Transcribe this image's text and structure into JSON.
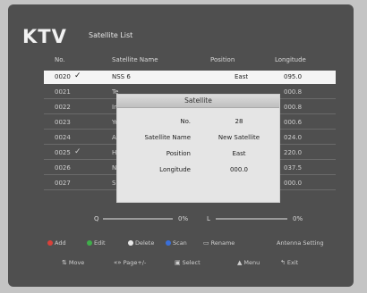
{
  "logo": "KTV",
  "title": "Satellite List",
  "columns": {
    "no": "No.",
    "name": "Satellite Name",
    "position": "Position",
    "longitude": "Longitude"
  },
  "rows": [
    {
      "no": "0020",
      "check": "✓",
      "name": "NSS 6",
      "position": "East",
      "longitude": "095.0"
    },
    {
      "no": "0021",
      "check": "",
      "name": "Te",
      "position": "",
      "longitude": "000.8"
    },
    {
      "no": "0022",
      "check": "",
      "name": "In",
      "position": "",
      "longitude": "000.8"
    },
    {
      "no": "0023",
      "check": "",
      "name": "Ye",
      "position": "",
      "longitude": "000.6"
    },
    {
      "no": "0024",
      "check": "",
      "name": "A",
      "position": "",
      "longitude": "024.0"
    },
    {
      "no": "0025",
      "check": "✓",
      "name": "Hi",
      "position": "",
      "longitude": "220.0"
    },
    {
      "no": "0026",
      "check": "",
      "name": "Ni",
      "position": "",
      "longitude": "037.5"
    },
    {
      "no": "0027",
      "check": "",
      "name": "Si",
      "position": "",
      "longitude": "000.0"
    }
  ],
  "dialog": {
    "title": "Satellite",
    "no_label": "No.",
    "no_value": "28",
    "name_label": "Satellite Name",
    "name_value": "New Satellite",
    "position_label": "Position",
    "position_value": "East",
    "longitude_label": "Longitude",
    "longitude_value": "000.0"
  },
  "signal": {
    "quality_label": "Q",
    "quality_value": "0%",
    "level_label": "L",
    "level_value": "0%"
  },
  "footer": {
    "add": "Add",
    "edit": "Edit",
    "delete": "Delete",
    "scan": "Scan",
    "rename": "Rename",
    "antenna": "Antenna Setting",
    "move": "Move",
    "page": "Page+/-",
    "select": "Select",
    "menu": "Menu",
    "exit": "Exit"
  },
  "colors": {
    "add": "#d9413a",
    "edit": "#3fae4a",
    "delete": "#e8e8e8",
    "scan": "#3a6fd9"
  }
}
